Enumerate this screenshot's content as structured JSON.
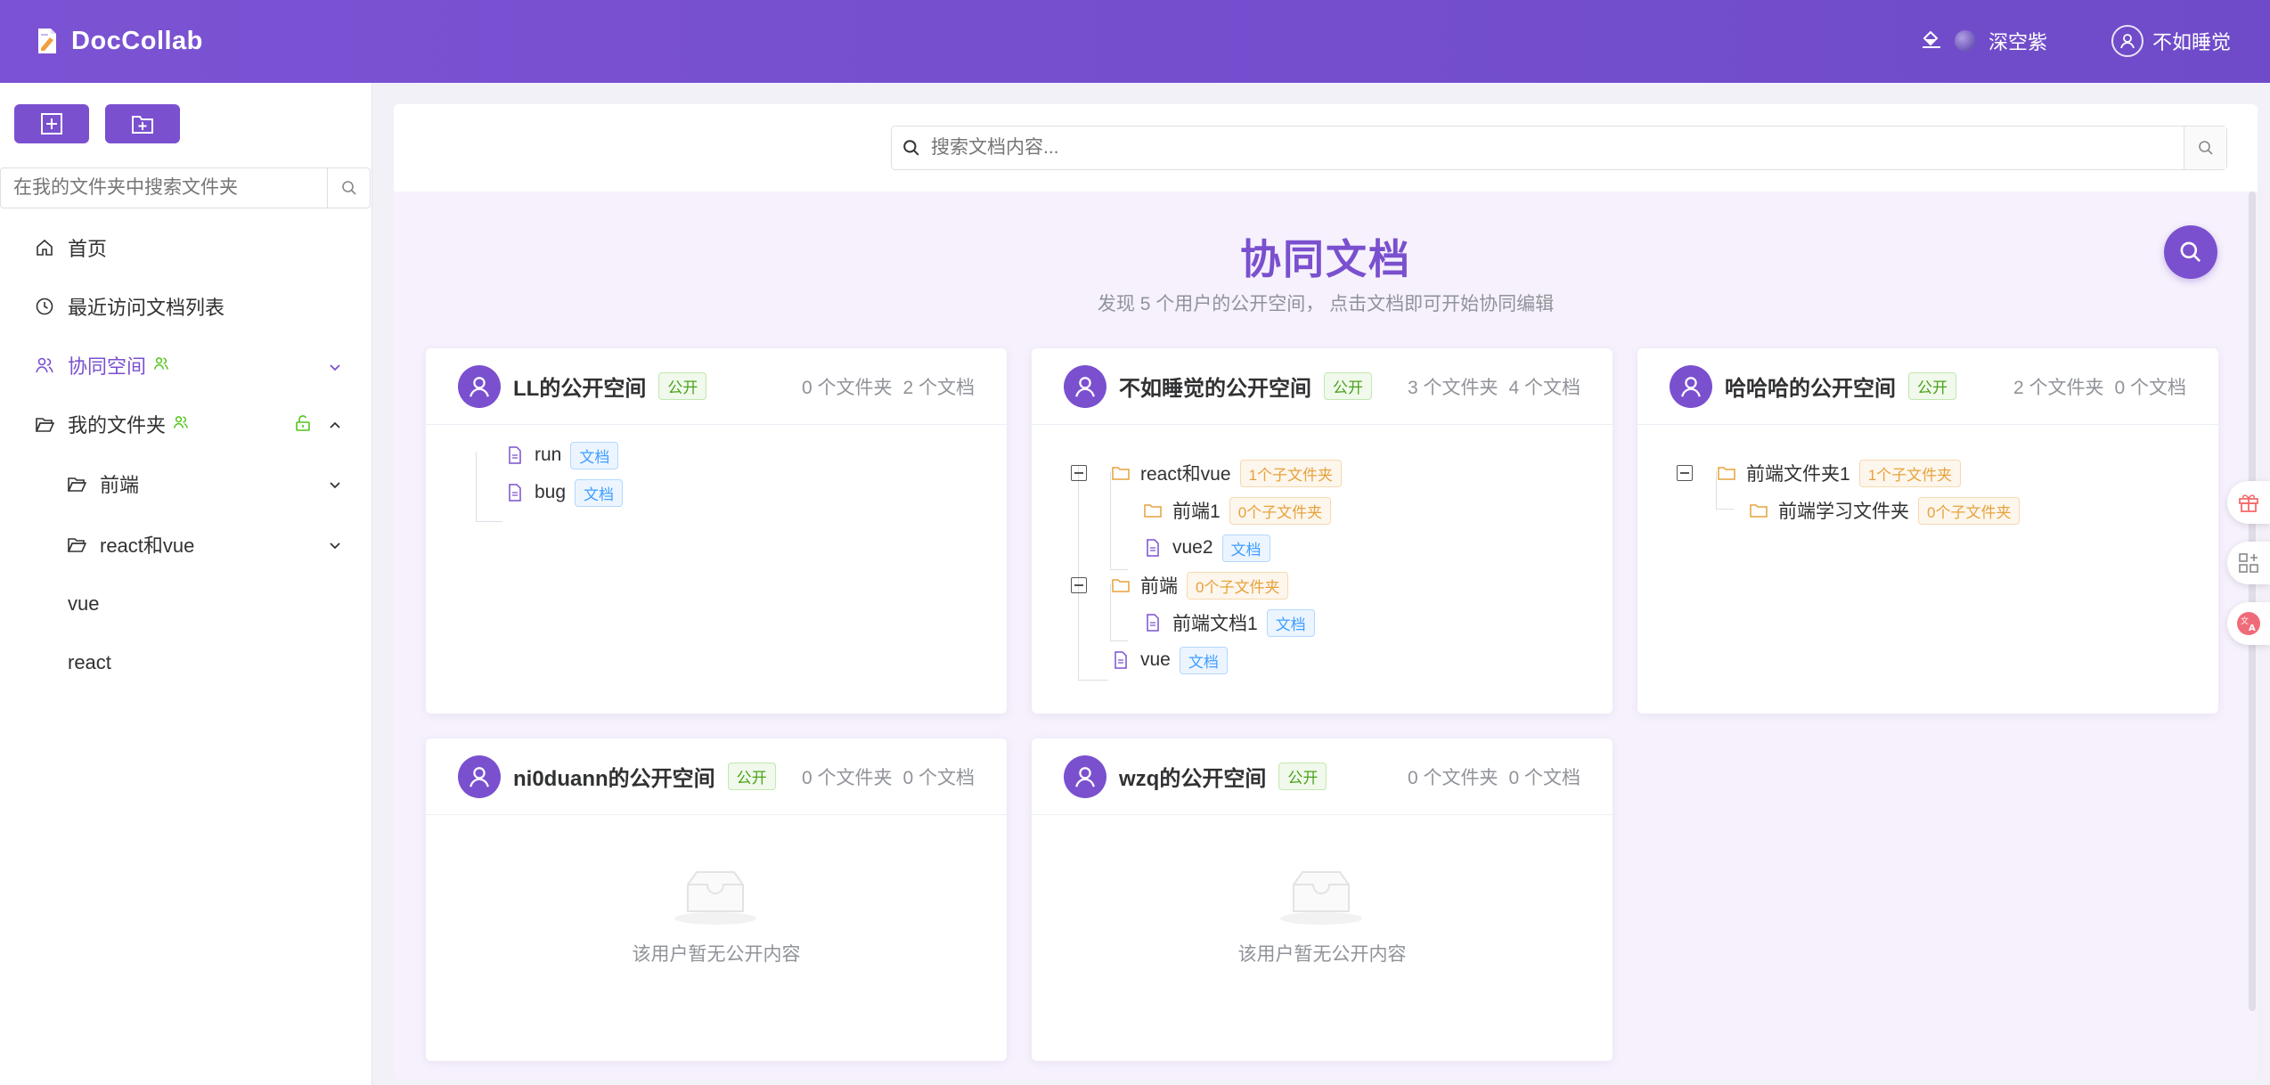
{
  "header": {
    "app_name": "DocCollab",
    "theme_label": "深空紫",
    "username": "不如睡觉"
  },
  "sidebar": {
    "search_placeholder": "在我的文件夹中搜索文件夹",
    "items": [
      {
        "label": "首页"
      },
      {
        "label": "最近访问文档列表"
      },
      {
        "label": "协同空间"
      },
      {
        "label": "我的文件夹"
      },
      {
        "label": "前端"
      },
      {
        "label": "react和vue"
      },
      {
        "label": "vue"
      },
      {
        "label": "react"
      }
    ]
  },
  "main": {
    "search_placeholder": "搜索文档内容...",
    "title": "协同文档",
    "subtitle": "发现 5 个用户的公开空间， 点击文档即可开始协同编辑",
    "public_tag": "公开",
    "doc_tag": "文档",
    "empty_text": "该用户暂无公开内容",
    "cards": [
      {
        "title": "LL的公开空间",
        "folders": "0 个文件夹",
        "docs": "2 个文档",
        "nodes": [
          {
            "name": "run"
          },
          {
            "name": "bug"
          }
        ]
      },
      {
        "title": "不如睡觉的公开空间",
        "folders": "3 个文件夹",
        "docs": "4 个文档",
        "nodes": [
          {
            "name": "react和vue",
            "tag": "1个子文件夹"
          },
          {
            "name": "前端1",
            "tag": "0个子文件夹"
          },
          {
            "name": "vue2"
          },
          {
            "name": "前端",
            "tag": "0个子文件夹"
          },
          {
            "name": "前端文档1"
          },
          {
            "name": "vue"
          }
        ]
      },
      {
        "title": "哈哈哈的公开空间",
        "folders": "2 个文件夹",
        "docs": "0 个文档",
        "nodes": [
          {
            "name": "前端文件夹1",
            "tag": "1个子文件夹"
          },
          {
            "name": "前端学习文件夹",
            "tag": "0个子文件夹"
          }
        ]
      },
      {
        "title": "ni0duann的公开空间",
        "folders": "0 个文件夹",
        "docs": "0 个文档"
      },
      {
        "title": "wzq的公开空间",
        "folders": "0 个文件夹",
        "docs": "0 个文档"
      }
    ]
  },
  "colors": {
    "primary": "#7a50cf",
    "public_green": "#4aa21b",
    "doc_blue": "#409eff",
    "folder_orange": "#e6a23c"
  }
}
